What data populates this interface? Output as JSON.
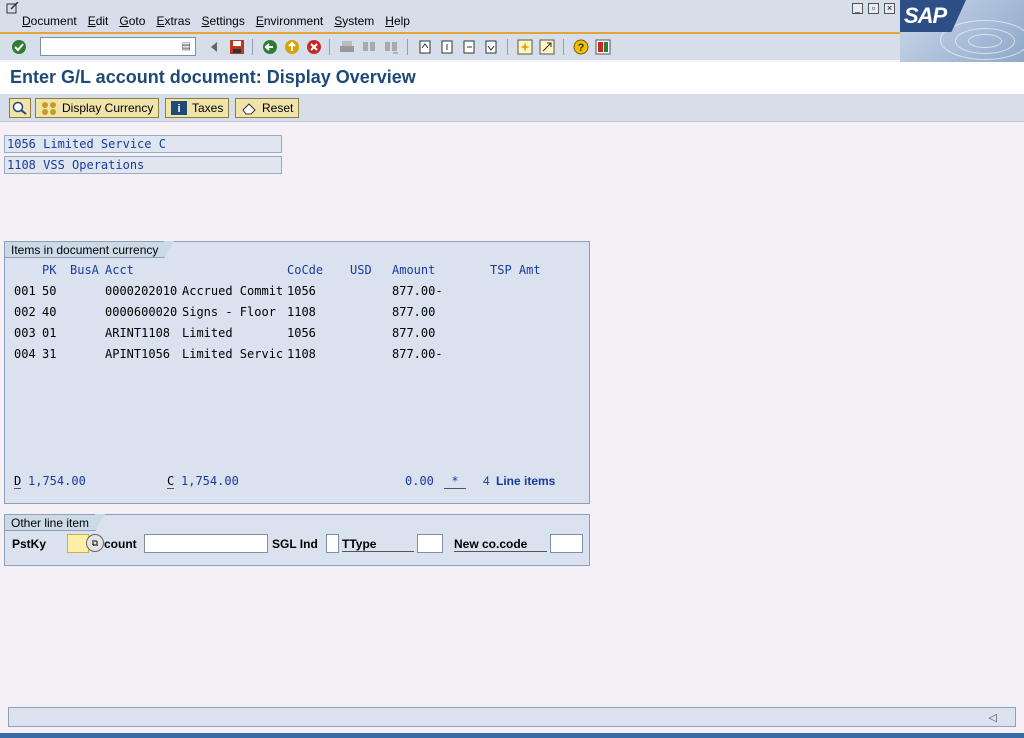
{
  "menu": {
    "items": [
      "Document",
      "Edit",
      "Goto",
      "Extras",
      "Settings",
      "Environment",
      "System",
      "Help"
    ]
  },
  "brand": {
    "logo_text": "SAP"
  },
  "toolbar": {
    "command_field_value": "",
    "icons": [
      "enter-icon",
      "back-icon",
      "save-icon",
      "back-arrow-icon",
      "exit-icon",
      "cancel-icon",
      "print-icon",
      "find-icon",
      "find-next-icon",
      "first-page-icon",
      "prev-page-icon",
      "next-page-icon",
      "last-page-icon",
      "create-session-icon",
      "shortcut-icon",
      "help-icon",
      "layout-icon"
    ]
  },
  "page": {
    "title": "Enter G/L account document: Display Overview"
  },
  "app_toolbar": {
    "display_currency": "Display Currency",
    "taxes": "Taxes",
    "reset": "Reset"
  },
  "header_fields": {
    "company1": "1056 Limited Service C",
    "company2": "1108 VSS Operations"
  },
  "items_group": {
    "title": "Items in document currency",
    "columns": {
      "pk": "PK",
      "busa": "BusA",
      "acct": "Acct",
      "cocde": "CoCde",
      "usd": "USD",
      "amount": "Amount",
      "tsp": "TSP Amt"
    },
    "rows": [
      {
        "line": "001",
        "pk": "50",
        "acct": "0000202010",
        "text": "Accrued Commit",
        "cocde": "1056",
        "amount": "877.00-"
      },
      {
        "line": "002",
        "pk": "40",
        "acct": "0000600020",
        "text": "Signs - Floor",
        "cocde": "1108",
        "amount": "877.00"
      },
      {
        "line": "003",
        "pk": "01",
        "acct": "ARINT1108",
        "text": "Limited",
        "cocde": "1056",
        "amount": "877.00"
      },
      {
        "line": "004",
        "pk": "31",
        "acct": "APINT1056",
        "text": "Limited Servic",
        "cocde": "1108",
        "amount": "877.00-"
      }
    ],
    "totals": {
      "d_label": "D",
      "d_value": "1,754.00",
      "c_label": "C",
      "c_value": "1,754.00",
      "balance": "0.00",
      "star": "*",
      "count": "4",
      "count_label": "Line items"
    }
  },
  "other_group": {
    "title": "Other line item",
    "pstky_label": "PstKy",
    "account_label": "count",
    "sgl_label": "SGL Ind",
    "ttype_label": "TType",
    "newco_label": "New co.code",
    "pstky_value": "",
    "account_value": "",
    "sgl_value": "",
    "ttype_value": "",
    "newco_value": ""
  },
  "status": {
    "message": ""
  },
  "colors": {
    "toolbar": "#d6deea",
    "title": "#1d4a78",
    "field_text": "#1a3aa0",
    "button": "#f0e4a8",
    "orange": "#e3a43a"
  }
}
